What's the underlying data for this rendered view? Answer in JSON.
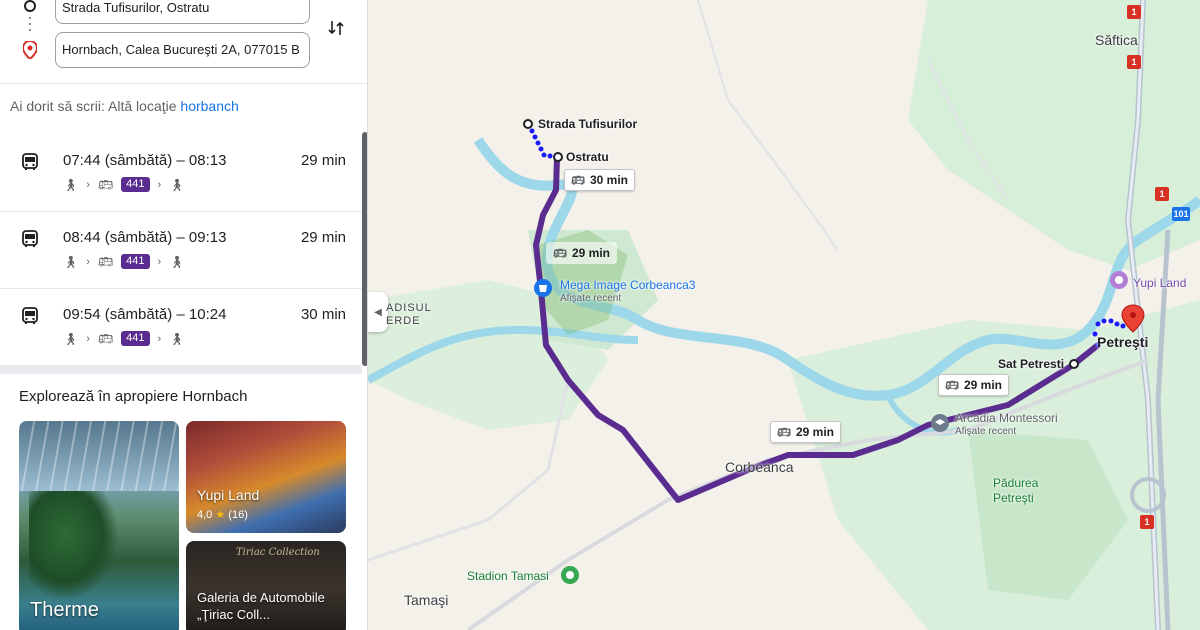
{
  "directions": {
    "origin": "Strada Tufisurilor, Ostratu",
    "destination": "Hornbach, Calea Bucureşti 2A, 077015 B",
    "swap_icon": "swap-vert-icon"
  },
  "suggestion": {
    "prefix": "Ai dorit să scrii: Altă locaţie",
    "link": "horbanch"
  },
  "routes": [
    {
      "time": "07:44 (sâmbătă) – 08:13",
      "duration": "29 min",
      "line": "441"
    },
    {
      "time": "08:44 (sâmbătă) – 09:13",
      "duration": "29 min",
      "line": "441"
    },
    {
      "time": "09:54 (sâmbătă) – 10:24",
      "duration": "30 min",
      "line": "441"
    }
  ],
  "explore": {
    "title": "Explorează în apropiere Hornbach",
    "cards": [
      {
        "name": "Therme"
      },
      {
        "name": "Yupi Land",
        "rating": "4,0",
        "reviews": "(16)"
      },
      {
        "name": "Galeria de Automobile „Ţiriac Coll...",
        "brand": "Tiriac Collection"
      }
    ]
  },
  "map": {
    "labels": {
      "strada": "Strada Tufisurilor",
      "ostratu": "Ostratu",
      "mega": "Mega Image Corbeanca3",
      "mega_sub": "Afişate recent",
      "paradis1": "ADISUL",
      "paradis2": "ERDE",
      "corbeanca": "Corbeanca",
      "arcadia": "Arcadia Montessori",
      "arcadia_sub": "Afişate recent",
      "sat_petresti": "Sat Petresti",
      "petresti": "Petreşti",
      "yupi": "Yupi Land",
      "saftica": "Săftica",
      "padurea1": "Pădurea",
      "padurea2": "Petreşti",
      "stadion": "Stadion Tamasi",
      "tamasi": "Tamaşi"
    },
    "time_boxes": [
      "30 min",
      "29 min",
      "29 min",
      "29 min"
    ],
    "shields": [
      "1",
      "1",
      "1",
      "1",
      "101"
    ],
    "route_color": "#5b2c8f",
    "walk_color": "#1a1aff"
  }
}
